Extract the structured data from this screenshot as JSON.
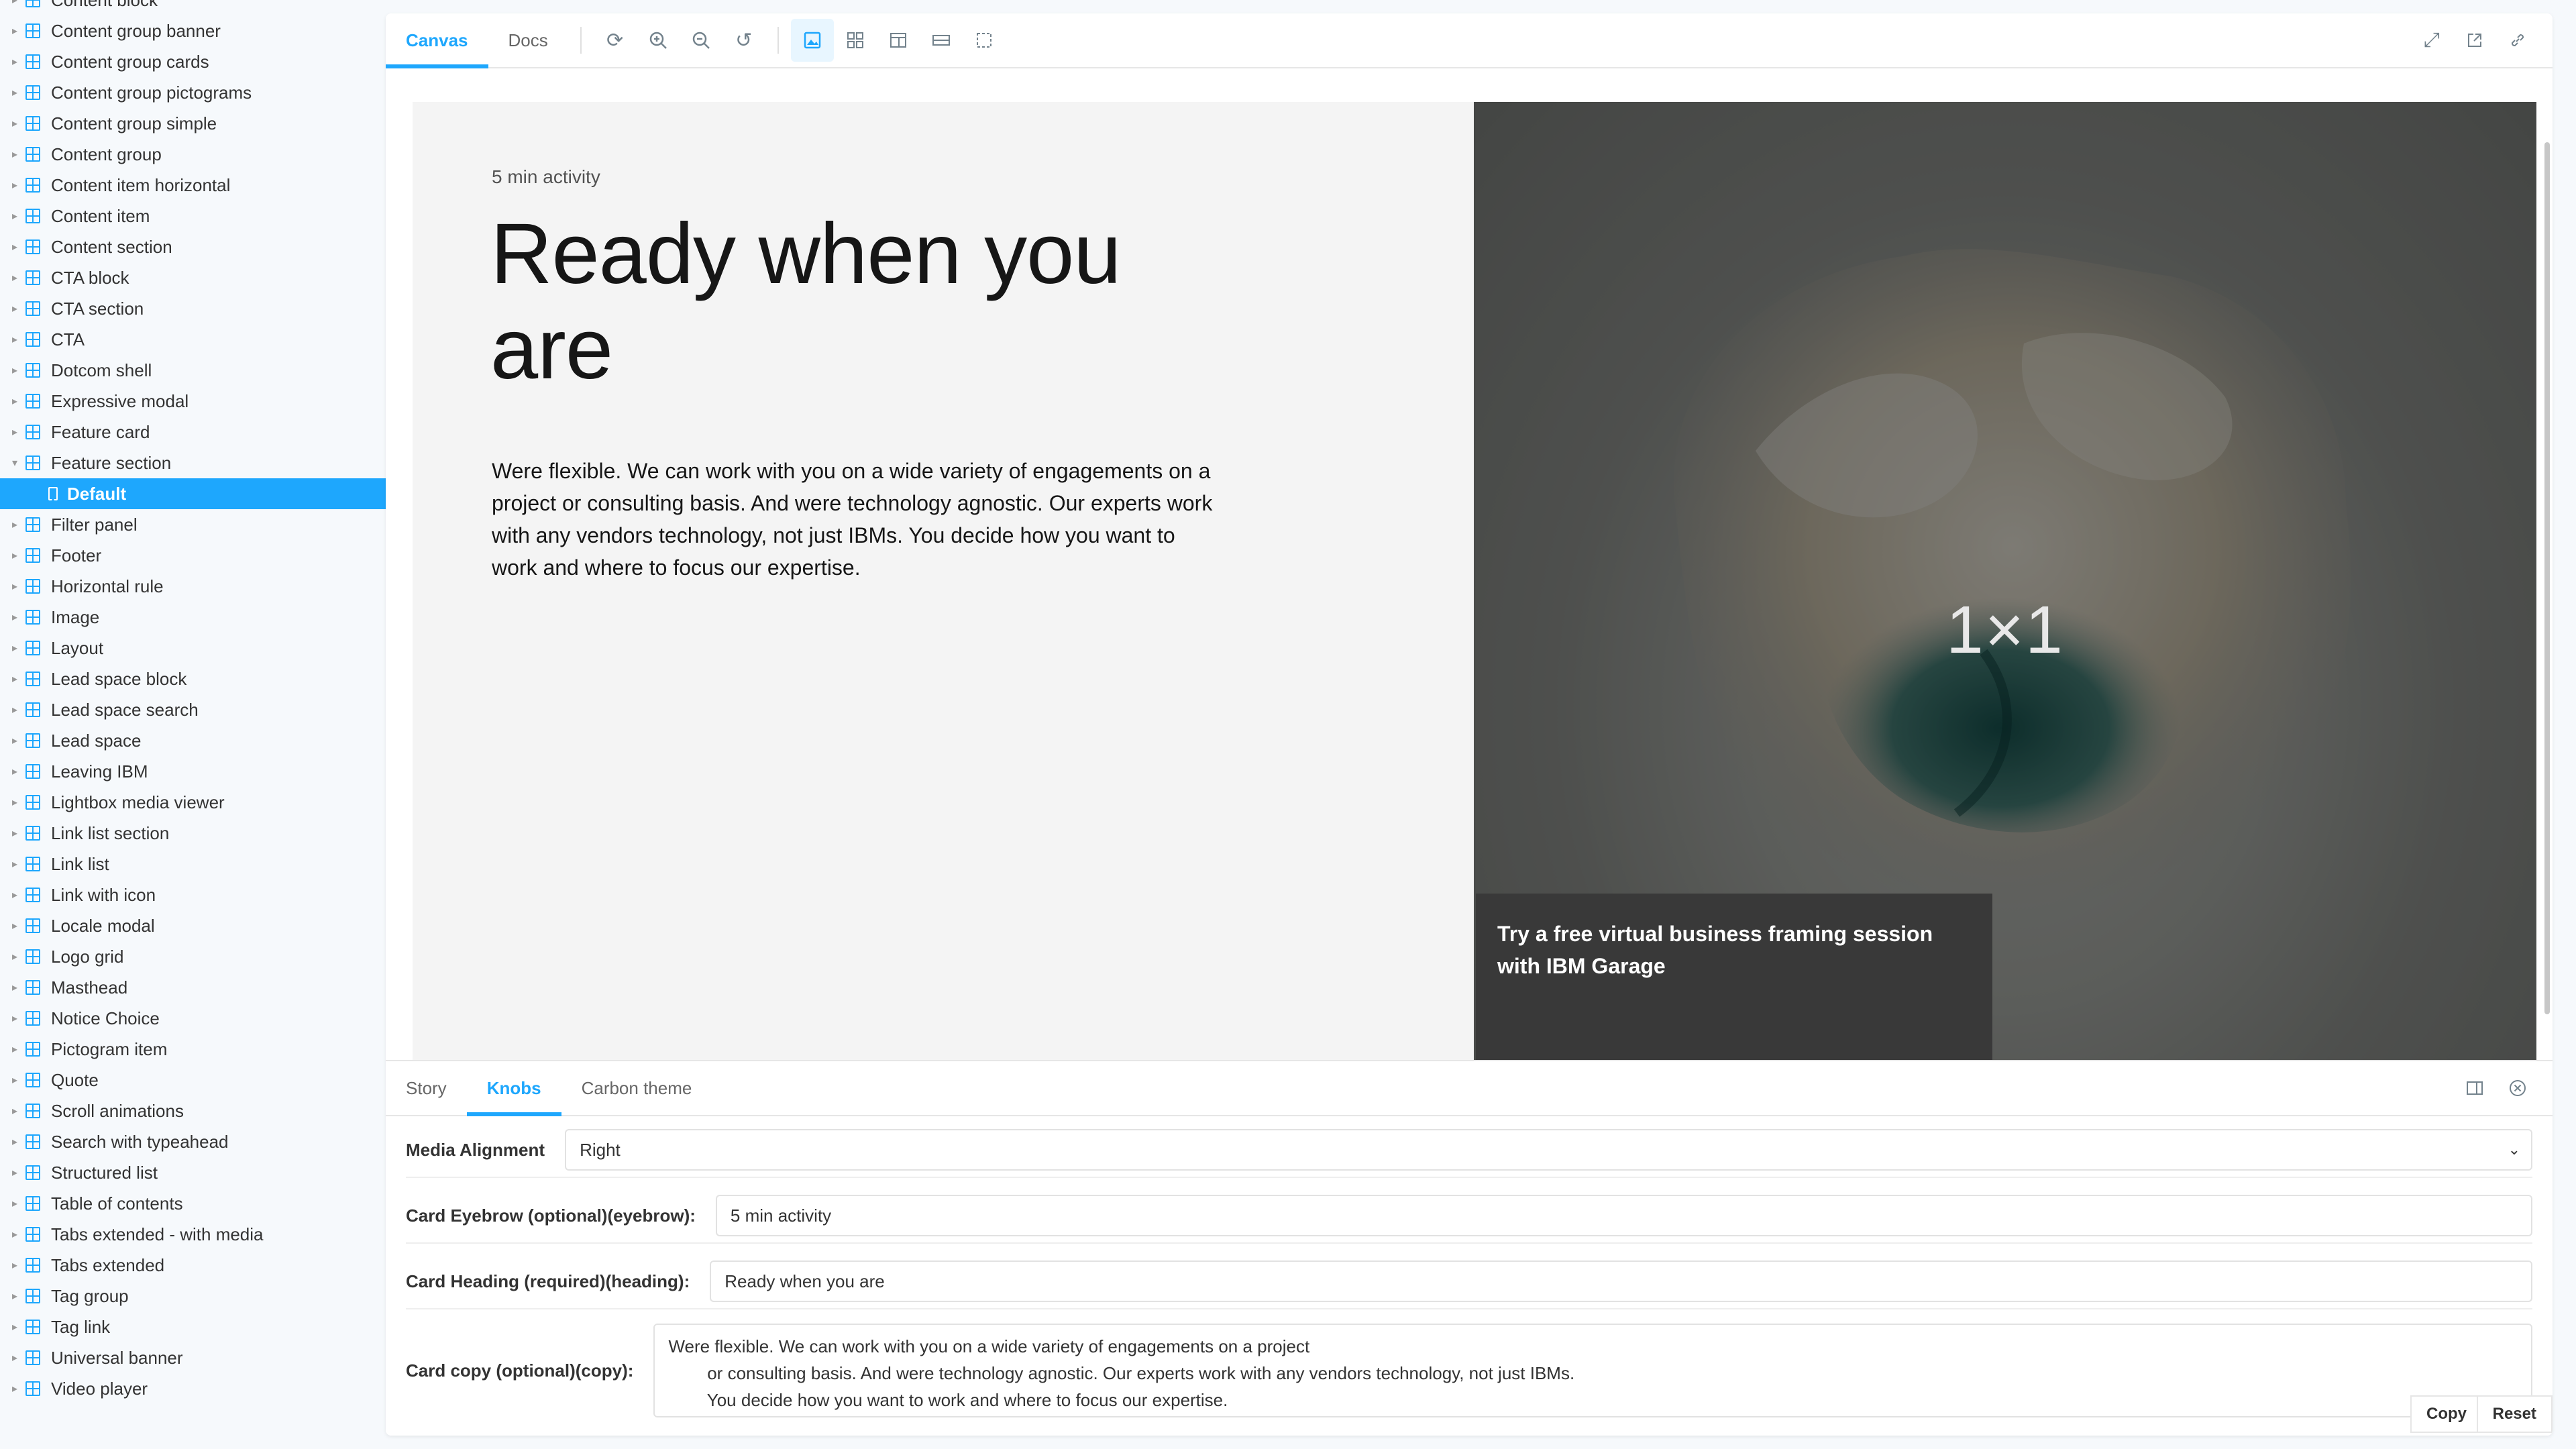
{
  "sidebar": {
    "items": [
      {
        "label": "Content block",
        "type": "group"
      },
      {
        "label": "Content group banner",
        "type": "group"
      },
      {
        "label": "Content group cards",
        "type": "group"
      },
      {
        "label": "Content group pictograms",
        "type": "group"
      },
      {
        "label": "Content group simple",
        "type": "group"
      },
      {
        "label": "Content group",
        "type": "group"
      },
      {
        "label": "Content item horizontal",
        "type": "group"
      },
      {
        "label": "Content item",
        "type": "group"
      },
      {
        "label": "Content section",
        "type": "group"
      },
      {
        "label": "CTA block",
        "type": "group"
      },
      {
        "label": "CTA section",
        "type": "group"
      },
      {
        "label": "CTA",
        "type": "group"
      },
      {
        "label": "Dotcom shell",
        "type": "group"
      },
      {
        "label": "Expressive modal",
        "type": "group"
      },
      {
        "label": "Feature card",
        "type": "group"
      },
      {
        "label": "Feature section",
        "type": "group",
        "expanded": true
      },
      {
        "label": "Default",
        "type": "story",
        "selected": true
      },
      {
        "label": "Filter panel",
        "type": "group"
      },
      {
        "label": "Footer",
        "type": "group"
      },
      {
        "label": "Horizontal rule",
        "type": "group"
      },
      {
        "label": "Image",
        "type": "group"
      },
      {
        "label": "Layout",
        "type": "group"
      },
      {
        "label": "Lead space block",
        "type": "group"
      },
      {
        "label": "Lead space search",
        "type": "group"
      },
      {
        "label": "Lead space",
        "type": "group"
      },
      {
        "label": "Leaving IBM",
        "type": "group"
      },
      {
        "label": "Lightbox media viewer",
        "type": "group"
      },
      {
        "label": "Link list section",
        "type": "group"
      },
      {
        "label": "Link list",
        "type": "group"
      },
      {
        "label": "Link with icon",
        "type": "group"
      },
      {
        "label": "Locale modal",
        "type": "group"
      },
      {
        "label": "Logo grid",
        "type": "group"
      },
      {
        "label": "Masthead",
        "type": "group"
      },
      {
        "label": "Notice Choice",
        "type": "group"
      },
      {
        "label": "Pictogram item",
        "type": "group"
      },
      {
        "label": "Quote",
        "type": "group"
      },
      {
        "label": "Scroll animations",
        "type": "group"
      },
      {
        "label": "Search with typeahead",
        "type": "group"
      },
      {
        "label": "Structured list",
        "type": "group"
      },
      {
        "label": "Table of contents",
        "type": "group"
      },
      {
        "label": "Tabs extended - with media",
        "type": "group"
      },
      {
        "label": "Tabs extended",
        "type": "group"
      },
      {
        "label": "Tag group",
        "type": "group"
      },
      {
        "label": "Tag link",
        "type": "group"
      },
      {
        "label": "Universal banner",
        "type": "group"
      },
      {
        "label": "Video player",
        "type": "group"
      }
    ]
  },
  "toolbar": {
    "tabs": [
      {
        "label": "Canvas",
        "active": true
      },
      {
        "label": "Docs",
        "active": false
      }
    ],
    "tools": [
      "reload-icon",
      "zoom-in-icon",
      "zoom-out-icon",
      "zoom-reset-icon",
      "background-icon",
      "grid-icon",
      "viewport-icon",
      "measure-icon",
      "outline-icon"
    ],
    "right_tools": [
      "fullscreen-icon",
      "open-new-tab-icon",
      "copy-link-icon"
    ]
  },
  "preview": {
    "eyebrow": "5 min activity",
    "heading": "Ready when you are",
    "copy": "Were flexible. We can work with you on a wide variety of engagements on a project or consulting basis. And were technology agnostic. Our experts work with any vendors technology, not just IBMs. You decide how you want to work and where to focus our expertise.",
    "media_label": "1×1",
    "card_text": "Try a free virtual business framing session with IBM Garage"
  },
  "addons": {
    "tabs": [
      {
        "label": "Story",
        "active": false
      },
      {
        "label": "Knobs",
        "active": true
      },
      {
        "label": "Carbon theme",
        "active": false
      }
    ],
    "knobs": {
      "media_alignment": {
        "label": "Media Alignment",
        "value": "Right"
      },
      "eyebrow": {
        "label": "Card Eyebrow (optional)(eyebrow):",
        "value": "5 min activity"
      },
      "heading": {
        "label": "Card Heading (required)(heading):",
        "value": "Ready when you are"
      },
      "copy": {
        "label": "Card copy (optional)(copy):",
        "value": "Were flexible. We can work with you on a wide variety of engagements on a project\n        or consulting basis. And were technology agnostic. Our experts work with any vendors technology, not just IBMs.\n        You decide how you want to work and where to focus our expertise."
      }
    },
    "copy_button": "Copy",
    "reset_button": "Reset"
  },
  "colors": {
    "accent": "#1ea7fd",
    "card_bg": "#393939",
    "section_bg": "#f4f4f4"
  }
}
